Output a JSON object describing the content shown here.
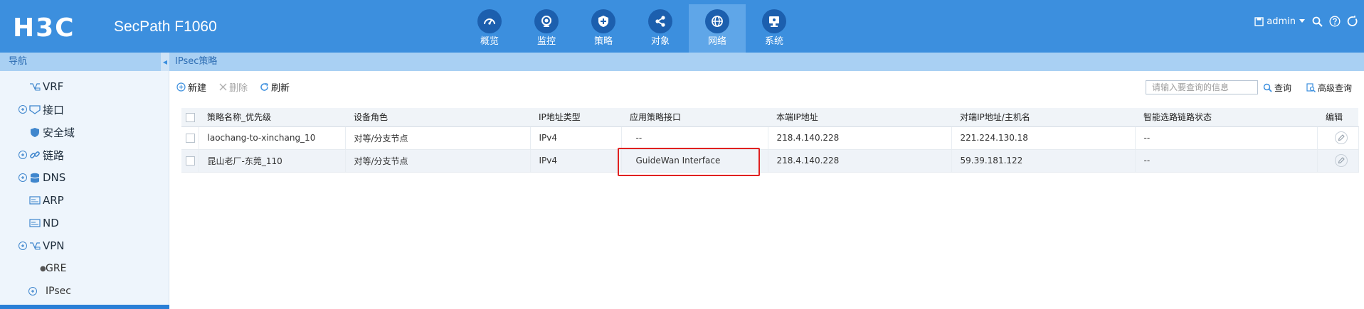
{
  "header": {
    "logo": "H3C",
    "product": "SecPath F1060",
    "nav": [
      {
        "label": "概览",
        "icon": "gauge-icon"
      },
      {
        "label": "监控",
        "icon": "eye-icon"
      },
      {
        "label": "策略",
        "icon": "shield-icon"
      },
      {
        "label": "对象",
        "icon": "share-icon"
      },
      {
        "label": "网络",
        "icon": "globe-icon",
        "active": true
      },
      {
        "label": "系统",
        "icon": "monitor-icon"
      }
    ],
    "user": "admin",
    "colors": {
      "bar": "#3c8fde",
      "active_tab": "#5fa6e8"
    }
  },
  "sidebar": {
    "title": "导航",
    "items": [
      {
        "label": "VRF",
        "icon": "vrf-icon"
      },
      {
        "label": "接口",
        "icon": "interface-icon",
        "expandable": true
      },
      {
        "label": "安全域",
        "icon": "security-zone-icon"
      },
      {
        "label": "链路",
        "icon": "link-icon",
        "expandable": true
      },
      {
        "label": "DNS",
        "icon": "dns-icon",
        "expandable": true
      },
      {
        "label": "ARP",
        "icon": "arp-icon"
      },
      {
        "label": "ND",
        "icon": "nd-icon"
      },
      {
        "label": "VPN",
        "icon": "vpn-icon",
        "expandable": true
      },
      {
        "label": "GRE",
        "sub": true
      },
      {
        "label": "IPsec",
        "expandable": true
      }
    ]
  },
  "main": {
    "tab": "IPsec策略",
    "toolbar": {
      "new_label": "新建",
      "delete_label": "删除",
      "refresh_label": "刷新",
      "search_placeholder": "请输入要查询的信息",
      "query_label": "查询",
      "advanced_label": "高级查询"
    },
    "table": {
      "columns": [
        "策略名称_优先级",
        "设备角色",
        "IP地址类型",
        "应用策略接口",
        "本端IP地址",
        "对端IP地址/主机名",
        "智能选路链路状态",
        "编辑"
      ],
      "rows": [
        [
          "laochang-to-xinchang_10",
          "对等/分支节点",
          "IPv4",
          "--",
          "218.4.140.228",
          "221.224.130.18",
          "--"
        ],
        [
          "昆山老厂-东莞_110",
          "对等/分支节点",
          "IPv4",
          "GuideWan Interface",
          "218.4.140.228",
          "59.39.181.122",
          "--"
        ]
      ]
    }
  }
}
